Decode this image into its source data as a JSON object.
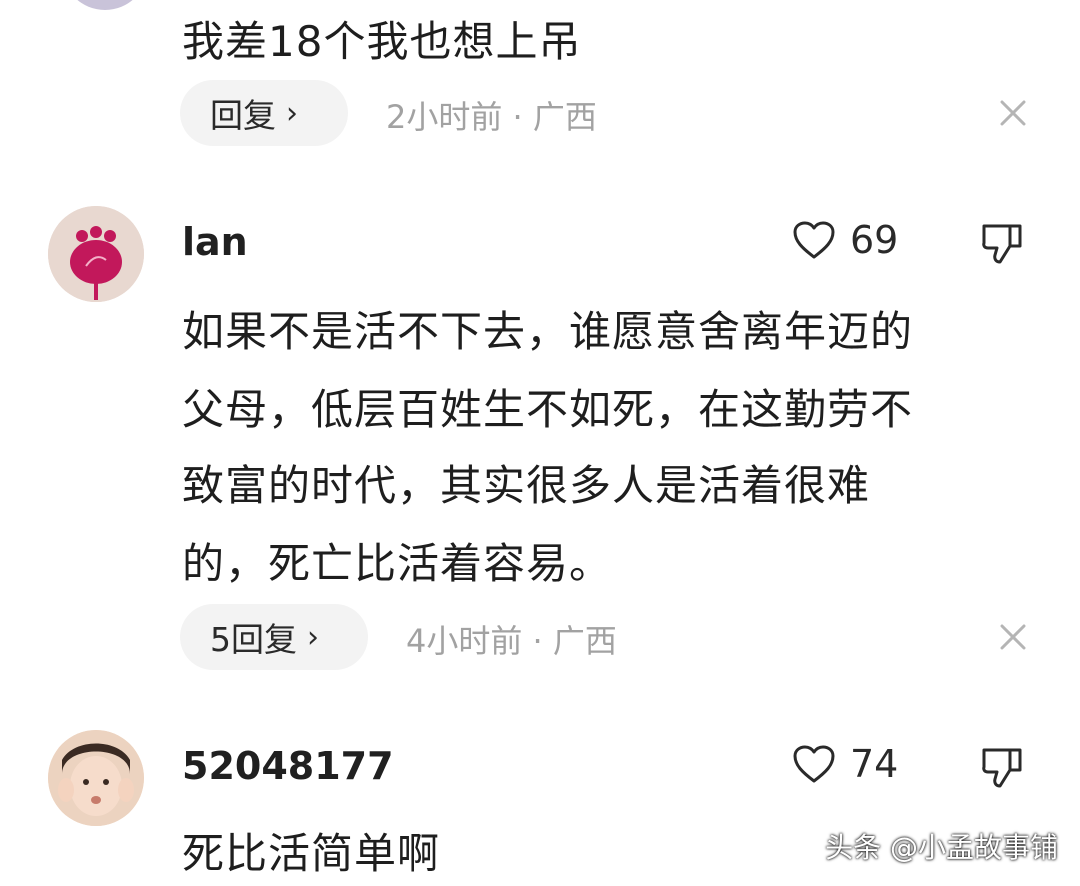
{
  "comments": [
    {
      "content": "我差18个我也想上吊",
      "reply_label": "回复",
      "meta": "2小时前 · 广西"
    },
    {
      "username": "lan",
      "like_count": "69",
      "content_lines": [
        "如果不是活不下去，谁愿意舍离年迈的",
        "父母，低层百姓生不如死，在这勤劳不",
        "致富的时代，其实很多人是活着很难",
        "的，死亡比活着容易。"
      ],
      "reply_label": "5回复",
      "meta": "4小时前 · 广西"
    },
    {
      "username": "52048177",
      "like_count": "74",
      "content": "死比活简单啊"
    }
  ],
  "watermark": "头条 @小孟故事铺",
  "icons": {
    "like": "heart-outline-icon",
    "dislike": "thumbs-down-icon",
    "close": "close-icon",
    "chevron": "chevron-right-icon"
  }
}
